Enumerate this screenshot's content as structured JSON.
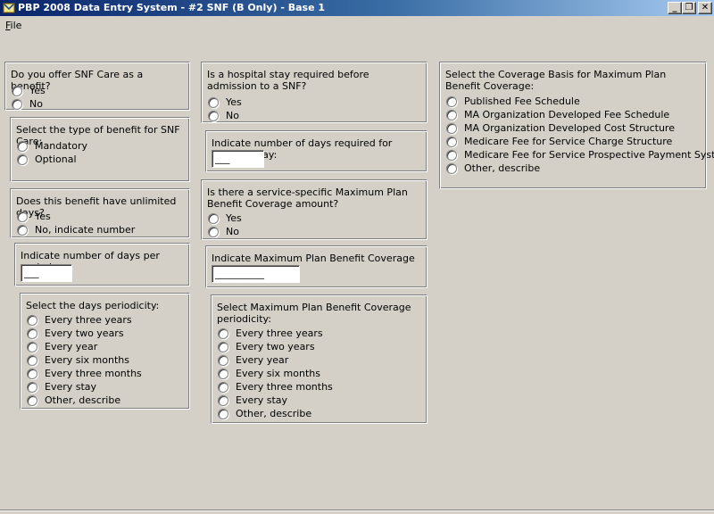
{
  "window": {
    "title": "PBP 2008 Data Entry System - #2 SNF (B Only) - Base 1",
    "minimize_glyph": "_",
    "restore_glyph": "❐",
    "close_glyph": "✕"
  },
  "menu": {
    "file_accel": "F",
    "file_rest": "ile"
  },
  "offer_snf": {
    "question": "Do you offer SNF Care as a benefit?",
    "options": [
      "Yes",
      "No"
    ]
  },
  "benefit_type": {
    "question": "Select the type of benefit for SNF Care:",
    "options": [
      "Mandatory",
      "Optional"
    ]
  },
  "unlimited_days": {
    "question": "Does this benefit have unlimited days?",
    "options": [
      "Yes",
      "No, indicate number"
    ]
  },
  "days_per_period": {
    "question": "Indicate number of days per period:",
    "value": "___"
  },
  "days_periodicity": {
    "question": "Select the days periodicity:",
    "options": [
      "Every three years",
      "Every two years",
      "Every year",
      "Every six months",
      "Every three months",
      "Every stay",
      "Other, describe"
    ]
  },
  "hospital_stay": {
    "question": "Is a hospital stay required before admission to a SNF?",
    "options": [
      "Yes",
      "No"
    ]
  },
  "hospital_days": {
    "question": "Indicate number of days required for hospital stay:",
    "value": "___"
  },
  "max_plan_specific": {
    "question": "Is there a service-specific Maximum Plan Benefit Coverage amount?",
    "options": [
      "Yes",
      "No"
    ]
  },
  "max_plan_amount": {
    "question": "Indicate Maximum Plan Benefit Coverage amount:",
    "value": "__________"
  },
  "max_plan_periodicity": {
    "question": "Select Maximum Plan Benefit Coverage periodicity:",
    "options": [
      "Every three years",
      "Every two years",
      "Every year",
      "Every six months",
      "Every three months",
      "Every stay",
      "Other, describe"
    ]
  },
  "coverage_basis": {
    "question": "Select the Coverage Basis for Maximum Plan Benefit Coverage:",
    "options": [
      "Published Fee Schedule",
      "MA Organization Developed Fee Schedule",
      "MA Organization Developed Cost Structure",
      "Medicare Fee for Service Charge Structure",
      "Medicare Fee for Service Prospective Payment System",
      "Other, describe"
    ]
  }
}
